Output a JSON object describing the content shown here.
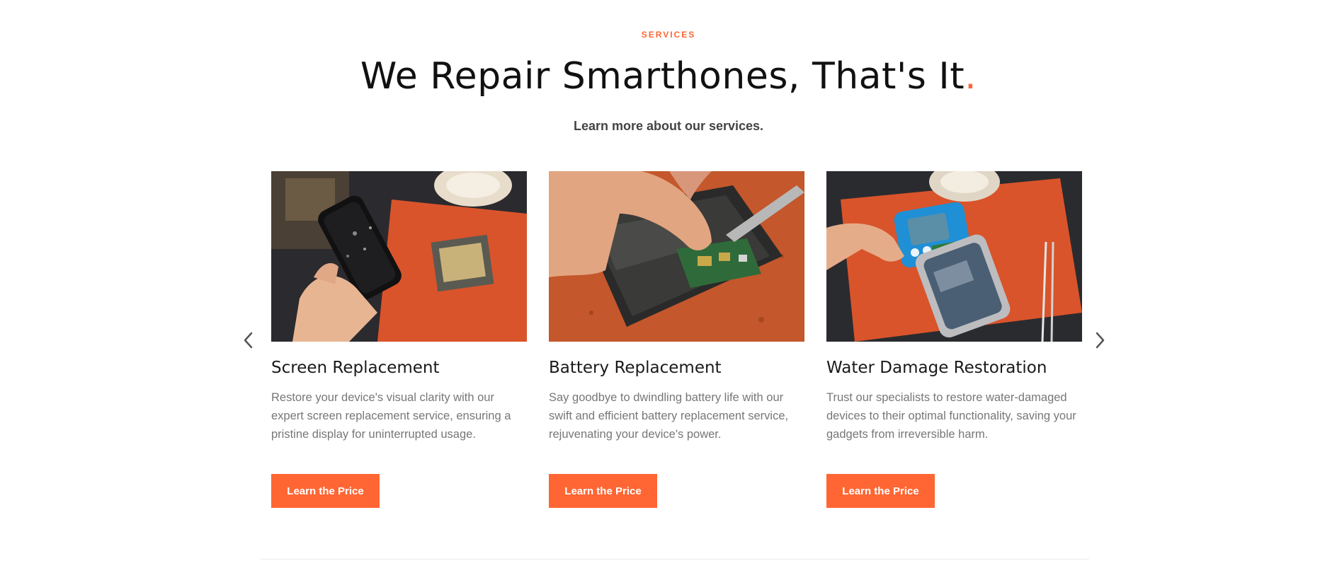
{
  "header": {
    "eyebrow": "SERVICES",
    "title": "We Repair Smarthones, That's It",
    "title_dot": ".",
    "subtitle": "Learn more about our services."
  },
  "colors": {
    "accent": "#ff6633",
    "title": "#111111",
    "body_text": "#777777"
  },
  "carousel": {
    "prev_icon": "chevron-left-icon",
    "next_icon": "chevron-right-icon",
    "cards": [
      {
        "title": "Screen Replacement",
        "description": "Restore your device's visual clarity with our expert screen replacement service, ensuring a pristine display for uninterrupted usage.",
        "button": "Learn the Price"
      },
      {
        "title": "Battery Replacement",
        "description": "Say goodbye to dwindling battery life with our swift and efficient battery replacement service, rejuvenating your device's power.",
        "button": "Learn the Price"
      },
      {
        "title": "Water Damage Restoration",
        "description": "Trust our specialists to restore water-damaged devices to their optimal functionality, saving your gadgets from irreversible harm.",
        "button": "Learn the Price"
      }
    ]
  }
}
